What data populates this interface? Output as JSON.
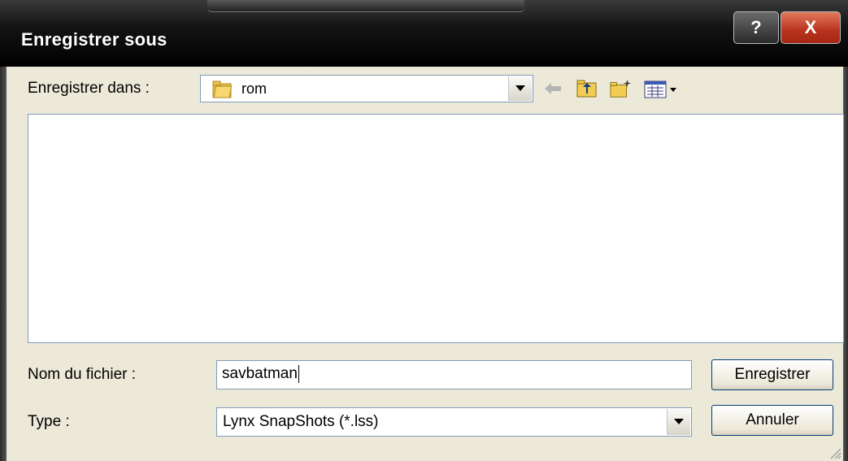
{
  "window": {
    "title": "Enregistrer sous",
    "help_label": "?",
    "close_label": "X"
  },
  "lookin": {
    "label": "Enregistrer dans :",
    "value": "rom"
  },
  "toolbar": {
    "icons": [
      "back-arrow-icon",
      "up-folder-icon",
      "new-folder-icon",
      "view-menu-icon"
    ]
  },
  "filename": {
    "label": "Nom du fichier :",
    "value": "savbatman"
  },
  "filetype": {
    "label": "Type :",
    "value": "Lynx SnapShots (*.lss)"
  },
  "buttons": {
    "save": "Enregistrer",
    "cancel": "Annuler"
  },
  "colors": {
    "titlebar": "#000000",
    "close": "#c1401f",
    "dialog_bg": "#ece9d8",
    "field_border": "#7f9db9"
  }
}
